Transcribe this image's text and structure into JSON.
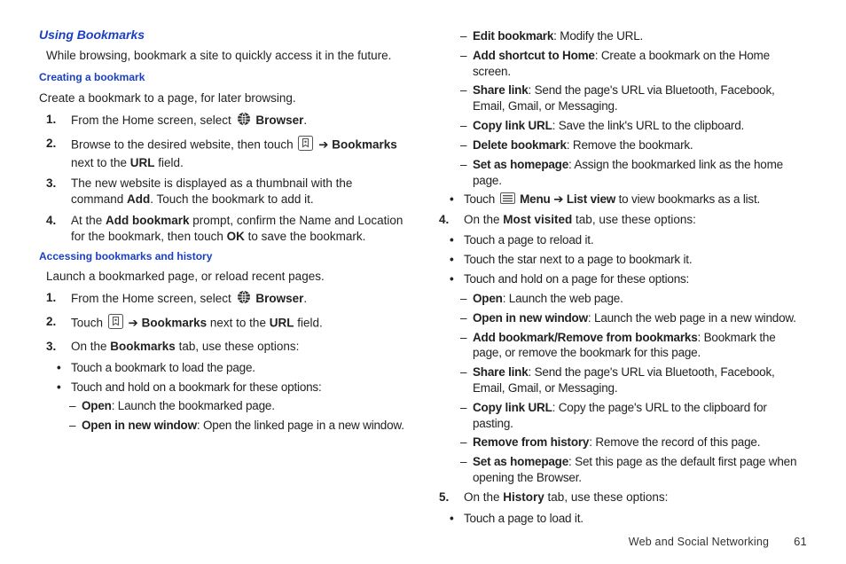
{
  "section_heading": "Using Bookmarks",
  "section_intro": "While browsing, bookmark a site to quickly access it in the future.",
  "sub1_title": "Creating a bookmark",
  "sub1_intro": "Create a bookmark to a page, for later browsing.",
  "sub1_steps": {
    "s1_a": "From the Home screen, select ",
    "s1_b": "Browser",
    "s1_c": ".",
    "s2_a": "Browse to the desired website, then touch ",
    "s2_b": "Bookmarks",
    "s2_c": " next to the ",
    "s2_d": "URL",
    "s2_e": " field.",
    "s3": "The new website is displayed as a thumbnail with the command ",
    "s3_b": "Add",
    "s3_c": ". Touch the bookmark to add it.",
    "s4_a": "At the ",
    "s4_b": "Add bookmark",
    "s4_c": " prompt, confirm the Name and Location for the bookmark, then touch ",
    "s4_d": "OK",
    "s4_e": " to save the bookmark."
  },
  "sub2_title": "Accessing bookmarks and history",
  "sub2_intro": "Launch a bookmarked page, or reload recent pages.",
  "sub2_s1_a": "From the Home screen, select ",
  "sub2_s1_b": "Browser",
  "sub2_s1_c": ".",
  "sub2_s2_a": "Touch ",
  "sub2_s2_b": "Bookmarks",
  "sub2_s2_c": " next to the ",
  "sub2_s2_d": "URL",
  "sub2_s2_e": " field.",
  "sub2_s3_a": "On the ",
  "sub2_s3_b": "Bookmarks",
  "sub2_s3_c": " tab, use these options:",
  "sub2_b1": "Touch a bookmark to load the page.",
  "sub2_b2": "Touch and hold on a bookmark for these options:",
  "sub2_d1_a": "Open",
  "sub2_d1_b": ": Launch the bookmarked page.",
  "sub2_d2_a": "Open in new window",
  "sub2_d2_b": ": Open the linked page in a new window.",
  "r_d1_a": "Edit bookmark",
  "r_d1_b": ": Modify the URL.",
  "r_d2_a": "Add shortcut to Home",
  "r_d2_b": ": Create a bookmark on the Home screen.",
  "r_d3_a": "Share link",
  "r_d3_b": ": Send the page's URL via Bluetooth, Facebook, Email, Gmail, or Messaging.",
  "r_d4_a": "Copy link URL",
  "r_d4_b": ": Save the link's URL to the clipboard.",
  "r_d5_a": "Delete bookmark",
  "r_d5_b": ": Remove the bookmark.",
  "r_d6_a": "Set as homepage",
  "r_d6_b": ": Assign the bookmarked link as the home page.",
  "r_b_touch_a": "Touch ",
  "r_b_touch_b": "Menu",
  "r_b_touch_c": "List view",
  "r_b_touch_d": " to view bookmarks as a list.",
  "r_s4_a": "On the ",
  "r_s4_b": "Most visited",
  "r_s4_c": " tab, use these options:",
  "r_s4_b1": "Touch a page to reload it.",
  "r_s4_b2": "Touch the star next to a page to bookmark it.",
  "r_s4_b3": "Touch and hold on a page for these options:",
  "r_s4_d1_a": "Open",
  "r_s4_d1_b": ": Launch the web page.",
  "r_s4_d2_a": "Open in new window",
  "r_s4_d2_b": ": Launch the web page in a new window.",
  "r_s4_d3_a": "Add bookmark/Remove from bookmarks",
  "r_s4_d3_b": ": Bookmark the page, or remove the bookmark for this page.",
  "r_s4_d4_a": "Share link",
  "r_s4_d4_b": ": Send the page's URL via Bluetooth, Facebook, Email, Gmail, or Messaging.",
  "r_s4_d5_a": "Copy link URL",
  "r_s4_d5_b": ": Copy the page's URL to the clipboard for pasting.",
  "r_s4_d6_a": "Remove from  history",
  "r_s4_d6_b": ": Remove the record of this page.",
  "r_s4_d7_a": "Set as homepage",
  "r_s4_d7_b": ": Set this page as the default first page when opening the Browser.",
  "r_s5_a": "On the ",
  "r_s5_b": "History",
  "r_s5_c": " tab, use these options:",
  "r_s5_b1": "Touch a page to load it.",
  "arrow": "  ➔  ",
  "footer_text": "Web and Social Networking",
  "page_number": "61"
}
